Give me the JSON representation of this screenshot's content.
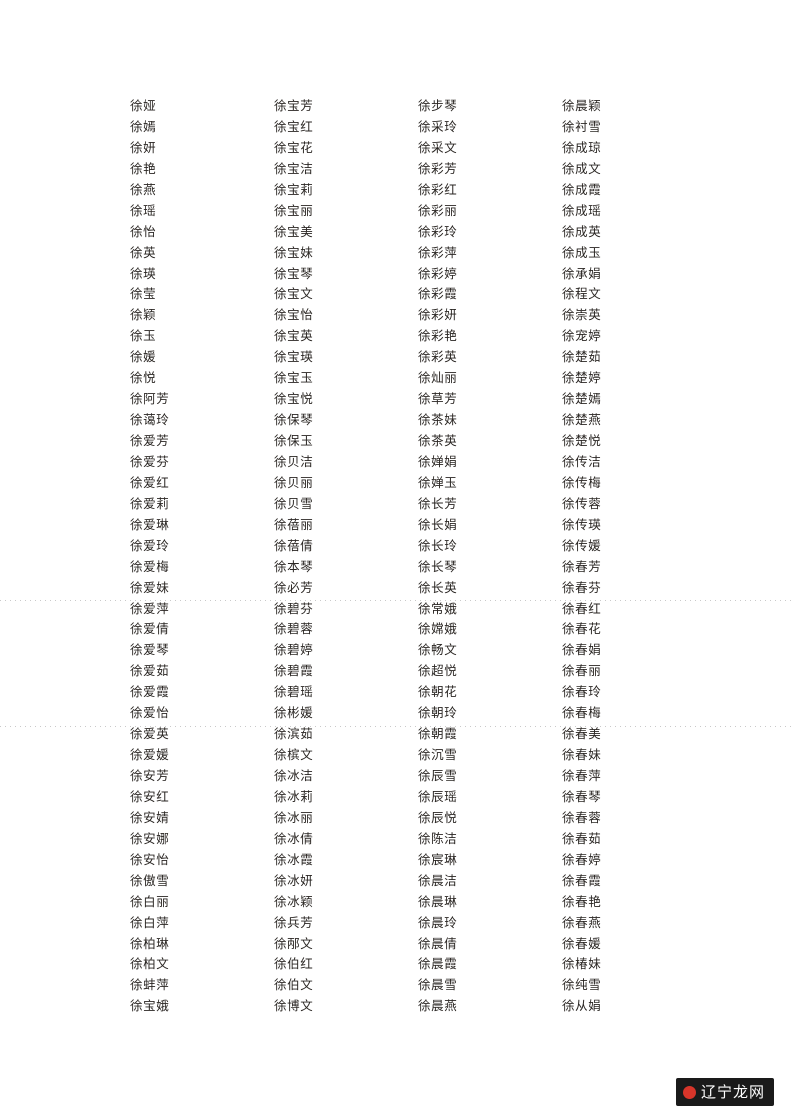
{
  "page": {
    "background_color": "#ffffff",
    "text_color": "#2a2623"
  },
  "name_list": {
    "columns": [
      {
        "index": 1,
        "names": [
          "徐娅",
          "徐嫣",
          "徐妍",
          "徐艳",
          "徐燕",
          "徐瑶",
          "徐怡",
          "徐英",
          "徐瑛",
          "徐莹",
          "徐颖",
          "徐玉",
          "徐媛",
          "徐悦",
          "徐阿芳",
          "徐蔼玲",
          "徐爱芳",
          "徐爱芬",
          "徐爱红",
          "徐爱莉",
          "徐爱琳",
          "徐爱玲",
          "徐爱梅",
          "徐爱妹",
          "徐爱萍",
          "徐爱倩",
          "徐爱琴",
          "徐爱茹",
          "徐爱霞",
          "徐爱怡",
          "徐爱英",
          "徐爱媛",
          "徐安芳",
          "徐安红",
          "徐安婧",
          "徐安娜",
          "徐安怡",
          "徐傲雪",
          "徐白丽",
          "徐白萍",
          "徐柏琳",
          "徐柏文",
          "徐蚌萍",
          "徐宝娥"
        ]
      },
      {
        "index": 2,
        "names": [
          "徐宝芳",
          "徐宝红",
          "徐宝花",
          "徐宝洁",
          "徐宝莉",
          "徐宝丽",
          "徐宝美",
          "徐宝妹",
          "徐宝琴",
          "徐宝文",
          "徐宝怡",
          "徐宝英",
          "徐宝瑛",
          "徐宝玉",
          "徐宝悦",
          "徐保琴",
          "徐保玉",
          "徐贝洁",
          "徐贝丽",
          "徐贝雪",
          "徐蓓丽",
          "徐蓓倩",
          "徐本琴",
          "徐必芳",
          "徐碧芬",
          "徐碧蓉",
          "徐碧婷",
          "徐碧霞",
          "徐碧瑶",
          "徐彬媛",
          "徐滨茹",
          "徐槟文",
          "徐冰洁",
          "徐冰莉",
          "徐冰丽",
          "徐冰倩",
          "徐冰霞",
          "徐冰妍",
          "徐冰颖",
          "徐兵芳",
          "徐邴文",
          "徐伯红",
          "徐伯文",
          "徐博文"
        ]
      },
      {
        "index": 3,
        "names": [
          "徐步琴",
          "徐采玲",
          "徐采文",
          "徐彩芳",
          "徐彩红",
          "徐彩丽",
          "徐彩玲",
          "徐彩萍",
          "徐彩婷",
          "徐彩霞",
          "徐彩妍",
          "徐彩艳",
          "徐彩英",
          "徐灿丽",
          "徐草芳",
          "徐茶妹",
          "徐茶英",
          "徐婵娟",
          "徐婵玉",
          "徐长芳",
          "徐长娟",
          "徐长玲",
          "徐长琴",
          "徐长英",
          "徐常娥",
          "徐嫦娥",
          "徐畅文",
          "徐超悦",
          "徐朝花",
          "徐朝玲",
          "徐朝霞",
          "徐沉雪",
          "徐辰雪",
          "徐辰瑶",
          "徐辰悦",
          "徐陈洁",
          "徐宸琳",
          "徐晨洁",
          "徐晨琳",
          "徐晨玲",
          "徐晨倩",
          "徐晨霞",
          "徐晨雪",
          "徐晨燕"
        ]
      },
      {
        "index": 4,
        "names": [
          "徐晨颖",
          "徐衬雪",
          "徐成琼",
          "徐成文",
          "徐成霞",
          "徐成瑶",
          "徐成英",
          "徐成玉",
          "徐承娟",
          "徐程文",
          "徐崇英",
          "徐宠婷",
          "徐楚茹",
          "徐楚婷",
          "徐楚嫣",
          "徐楚燕",
          "徐楚悦",
          "徐传洁",
          "徐传梅",
          "徐传蓉",
          "徐传瑛",
          "徐传媛",
          "徐春芳",
          "徐春芬",
          "徐春红",
          "徐春花",
          "徐春娟",
          "徐春丽",
          "徐春玲",
          "徐春梅",
          "徐春美",
          "徐春妹",
          "徐春萍",
          "徐春琴",
          "徐春蓉",
          "徐春茹",
          "徐春婷",
          "徐春霞",
          "徐春艳",
          "徐春燕",
          "徐春媛",
          "徐椿妹",
          "徐纯雪",
          "徐从娟"
        ]
      }
    ]
  },
  "watermark": {
    "text": "辽宁龙网",
    "badge_color": "#1a1a1a",
    "dot_color": "#d8352a",
    "text_color": "#ffffff"
  }
}
